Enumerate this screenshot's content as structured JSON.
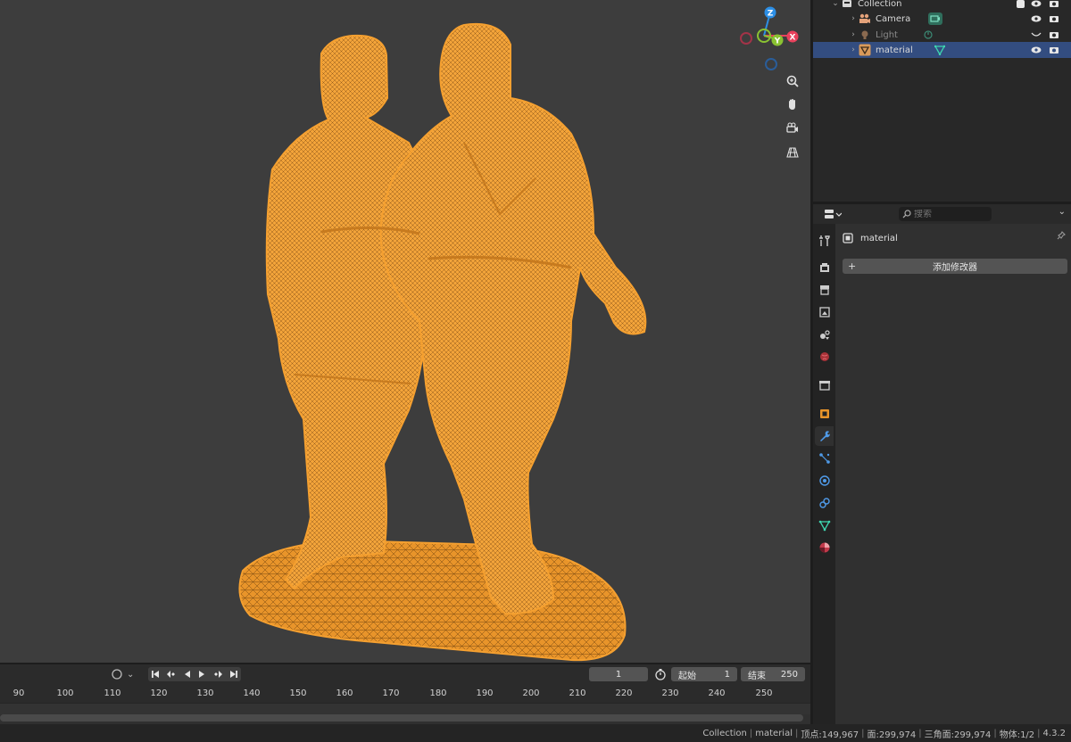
{
  "outliner": {
    "collection_label": "Collection",
    "items": [
      {
        "label": "Camera"
      },
      {
        "label": "Light"
      },
      {
        "label": "material"
      }
    ]
  },
  "properties": {
    "search_placeholder": "搜索",
    "object_name": "material",
    "add_modifier_label": "添加修改器"
  },
  "viewport": {
    "gizmo": {
      "x": "X",
      "y": "Y",
      "z": "Z"
    }
  },
  "timeline": {
    "current_frame": "1",
    "start_label": "起始",
    "start_value": "1",
    "end_label": "结束",
    "end_value": "250",
    "ticks": [
      "90",
      "100",
      "110",
      "120",
      "130",
      "140",
      "150",
      "160",
      "170",
      "180",
      "190",
      "200",
      "210",
      "220",
      "230",
      "240",
      "250"
    ]
  },
  "statusbar": {
    "collection": "Collection",
    "object": "material",
    "vertices": "顶点:149,967",
    "faces": "面:299,974",
    "triangles": "三角面:299,974",
    "objects": "物体:1/2",
    "version": "4.3.2"
  },
  "colors": {
    "viewport_bg": "#3d3d3d",
    "wireframe": "#f5a030",
    "selection": "#334d80",
    "axis_x": "#e8415c",
    "axis_y": "#8ac232",
    "axis_z": "#2c8fe6"
  }
}
